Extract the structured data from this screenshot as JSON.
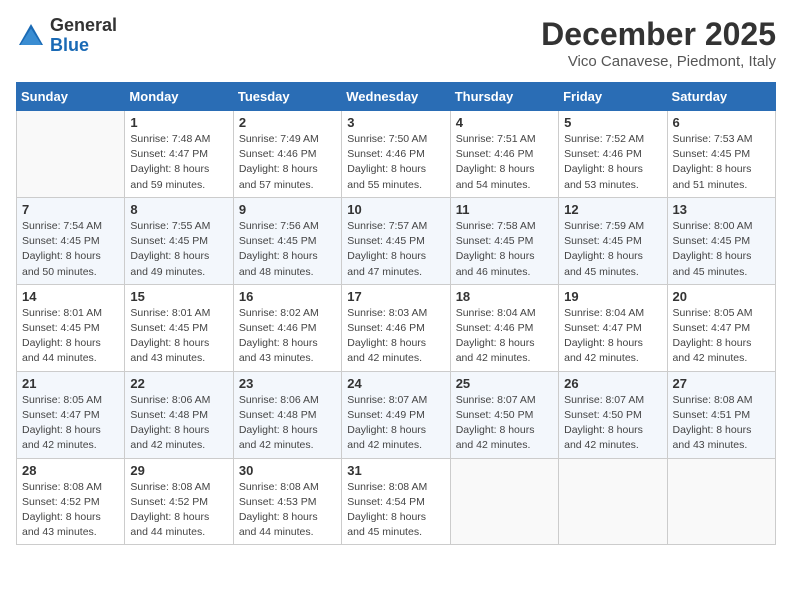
{
  "header": {
    "logo_line1": "General",
    "logo_line2": "Blue",
    "month_year": "December 2025",
    "location": "Vico Canavese, Piedmont, Italy"
  },
  "days_of_week": [
    "Sunday",
    "Monday",
    "Tuesday",
    "Wednesday",
    "Thursday",
    "Friday",
    "Saturday"
  ],
  "weeks": [
    [
      {
        "day": "",
        "text": ""
      },
      {
        "day": "1",
        "text": "Sunrise: 7:48 AM\nSunset: 4:47 PM\nDaylight: 8 hours\nand 59 minutes."
      },
      {
        "day": "2",
        "text": "Sunrise: 7:49 AM\nSunset: 4:46 PM\nDaylight: 8 hours\nand 57 minutes."
      },
      {
        "day": "3",
        "text": "Sunrise: 7:50 AM\nSunset: 4:46 PM\nDaylight: 8 hours\nand 55 minutes."
      },
      {
        "day": "4",
        "text": "Sunrise: 7:51 AM\nSunset: 4:46 PM\nDaylight: 8 hours\nand 54 minutes."
      },
      {
        "day": "5",
        "text": "Sunrise: 7:52 AM\nSunset: 4:46 PM\nDaylight: 8 hours\nand 53 minutes."
      },
      {
        "day": "6",
        "text": "Sunrise: 7:53 AM\nSunset: 4:45 PM\nDaylight: 8 hours\nand 51 minutes."
      }
    ],
    [
      {
        "day": "7",
        "text": "Sunrise: 7:54 AM\nSunset: 4:45 PM\nDaylight: 8 hours\nand 50 minutes."
      },
      {
        "day": "8",
        "text": "Sunrise: 7:55 AM\nSunset: 4:45 PM\nDaylight: 8 hours\nand 49 minutes."
      },
      {
        "day": "9",
        "text": "Sunrise: 7:56 AM\nSunset: 4:45 PM\nDaylight: 8 hours\nand 48 minutes."
      },
      {
        "day": "10",
        "text": "Sunrise: 7:57 AM\nSunset: 4:45 PM\nDaylight: 8 hours\nand 47 minutes."
      },
      {
        "day": "11",
        "text": "Sunrise: 7:58 AM\nSunset: 4:45 PM\nDaylight: 8 hours\nand 46 minutes."
      },
      {
        "day": "12",
        "text": "Sunrise: 7:59 AM\nSunset: 4:45 PM\nDaylight: 8 hours\nand 45 minutes."
      },
      {
        "day": "13",
        "text": "Sunrise: 8:00 AM\nSunset: 4:45 PM\nDaylight: 8 hours\nand 45 minutes."
      }
    ],
    [
      {
        "day": "14",
        "text": "Sunrise: 8:01 AM\nSunset: 4:45 PM\nDaylight: 8 hours\nand 44 minutes."
      },
      {
        "day": "15",
        "text": "Sunrise: 8:01 AM\nSunset: 4:45 PM\nDaylight: 8 hours\nand 43 minutes."
      },
      {
        "day": "16",
        "text": "Sunrise: 8:02 AM\nSunset: 4:46 PM\nDaylight: 8 hours\nand 43 minutes."
      },
      {
        "day": "17",
        "text": "Sunrise: 8:03 AM\nSunset: 4:46 PM\nDaylight: 8 hours\nand 42 minutes."
      },
      {
        "day": "18",
        "text": "Sunrise: 8:04 AM\nSunset: 4:46 PM\nDaylight: 8 hours\nand 42 minutes."
      },
      {
        "day": "19",
        "text": "Sunrise: 8:04 AM\nSunset: 4:47 PM\nDaylight: 8 hours\nand 42 minutes."
      },
      {
        "day": "20",
        "text": "Sunrise: 8:05 AM\nSunset: 4:47 PM\nDaylight: 8 hours\nand 42 minutes."
      }
    ],
    [
      {
        "day": "21",
        "text": "Sunrise: 8:05 AM\nSunset: 4:47 PM\nDaylight: 8 hours\nand 42 minutes."
      },
      {
        "day": "22",
        "text": "Sunrise: 8:06 AM\nSunset: 4:48 PM\nDaylight: 8 hours\nand 42 minutes."
      },
      {
        "day": "23",
        "text": "Sunrise: 8:06 AM\nSunset: 4:48 PM\nDaylight: 8 hours\nand 42 minutes."
      },
      {
        "day": "24",
        "text": "Sunrise: 8:07 AM\nSunset: 4:49 PM\nDaylight: 8 hours\nand 42 minutes."
      },
      {
        "day": "25",
        "text": "Sunrise: 8:07 AM\nSunset: 4:50 PM\nDaylight: 8 hours\nand 42 minutes."
      },
      {
        "day": "26",
        "text": "Sunrise: 8:07 AM\nSunset: 4:50 PM\nDaylight: 8 hours\nand 42 minutes."
      },
      {
        "day": "27",
        "text": "Sunrise: 8:08 AM\nSunset: 4:51 PM\nDaylight: 8 hours\nand 43 minutes."
      }
    ],
    [
      {
        "day": "28",
        "text": "Sunrise: 8:08 AM\nSunset: 4:52 PM\nDaylight: 8 hours\nand 43 minutes."
      },
      {
        "day": "29",
        "text": "Sunrise: 8:08 AM\nSunset: 4:52 PM\nDaylight: 8 hours\nand 44 minutes."
      },
      {
        "day": "30",
        "text": "Sunrise: 8:08 AM\nSunset: 4:53 PM\nDaylight: 8 hours\nand 44 minutes."
      },
      {
        "day": "31",
        "text": "Sunrise: 8:08 AM\nSunset: 4:54 PM\nDaylight: 8 hours\nand 45 minutes."
      },
      {
        "day": "",
        "text": ""
      },
      {
        "day": "",
        "text": ""
      },
      {
        "day": "",
        "text": ""
      }
    ]
  ]
}
